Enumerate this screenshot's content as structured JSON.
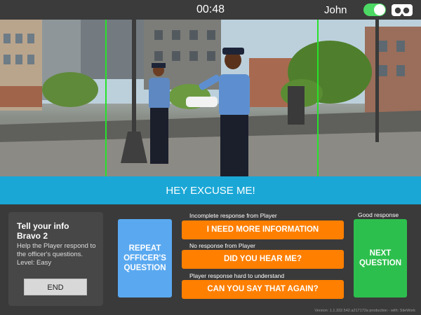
{
  "topbar": {
    "timer": "00:48",
    "user": "John",
    "toggle_on": true,
    "toggle_icon": "toggle-switch",
    "vr_icon": "vr-headset-icon",
    "accent": "#4cd964"
  },
  "caption": {
    "text": "HEY EXCUSE ME!",
    "color": "#1aa7d6"
  },
  "info_panel": {
    "title": "Tell your info\n Bravo 2",
    "description": "Help the Player respond to the officer's questions. Level: Easy",
    "end_label": "END"
  },
  "buttons": {
    "repeat_label": "REPEAT OFFICER'S QUESTION",
    "responses": [
      {
        "category": "Incomplete response from Player",
        "label": "I NEED MORE INFORMATION"
      },
      {
        "category": "No response from Player",
        "label": "DID YOU HEAR ME?"
      },
      {
        "category": "Player response hard to understand",
        "label": "CAN YOU SAY THAT AGAIN?"
      }
    ],
    "good_label": "Good response",
    "next_label": "NEXT QUESTION"
  },
  "version": "Version: 1.1.332.542.a217172a production - with: SiteWork",
  "colors": {
    "repeat": "#5aa9f0",
    "orange": "#ff7f00",
    "next": "#2dbf4d"
  }
}
